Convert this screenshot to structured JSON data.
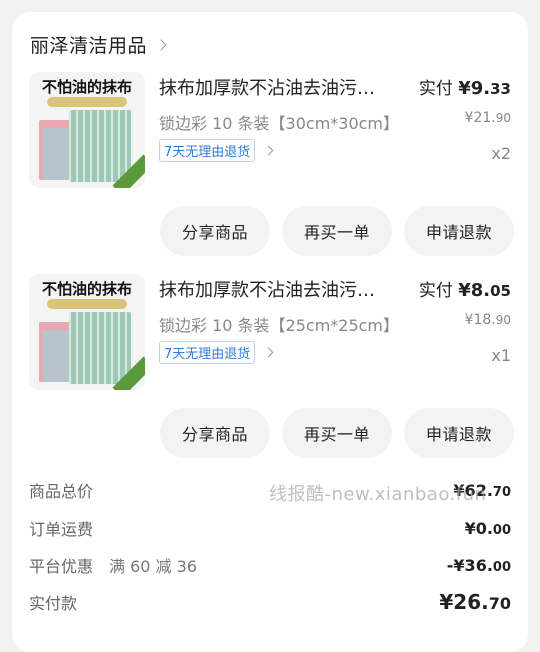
{
  "store": {
    "name": "丽泽清洁用品"
  },
  "items": [
    {
      "thumb_title": "不怕油的抹布",
      "title": "抹布加厚款不沾油去油污…",
      "spec": "锁边彩 10 条装【30cm*30cm】",
      "tag": "7天无理由退货",
      "paid_label": "实付 ",
      "paid_main": "¥9.",
      "paid_cents": "33",
      "orig_main": "¥21.",
      "orig_cents": "90",
      "qty": "x2",
      "buttons": [
        "分享商品",
        "再买一单",
        "申请退款"
      ]
    },
    {
      "thumb_title": "不怕油的抹布",
      "title": "抹布加厚款不沾油去油污…",
      "spec": "锁边彩 10 条装【25cm*25cm】",
      "tag": "7天无理由退货",
      "paid_label": "实付 ",
      "paid_main": "¥8.",
      "paid_cents": "05",
      "orig_main": "¥18.",
      "orig_cents": "90",
      "qty": "x1",
      "buttons": [
        "分享商品",
        "再买一单",
        "申请退款"
      ]
    }
  ],
  "summary": {
    "total_label": "商品总价",
    "total_main": "¥62.",
    "total_cents": "70",
    "shipping_label": "订单运费",
    "shipping_main": "¥0.",
    "shipping_cents": "00",
    "promo_label": "平台优惠",
    "promo_detail": "满 60 减 36",
    "promo_main": "-¥36.",
    "promo_cents": "00",
    "final_label": "实付款",
    "final_main": "¥26.",
    "final_cents": "70"
  },
  "watermark": "线报酷-new.xianbao.fun",
  "colors": {
    "tag_blue": "#2f7bd9",
    "cloth_green": "#9ec8b8",
    "cloth_pink": "#e8a8b0",
    "cloth_gray": "#b8c4cc"
  }
}
